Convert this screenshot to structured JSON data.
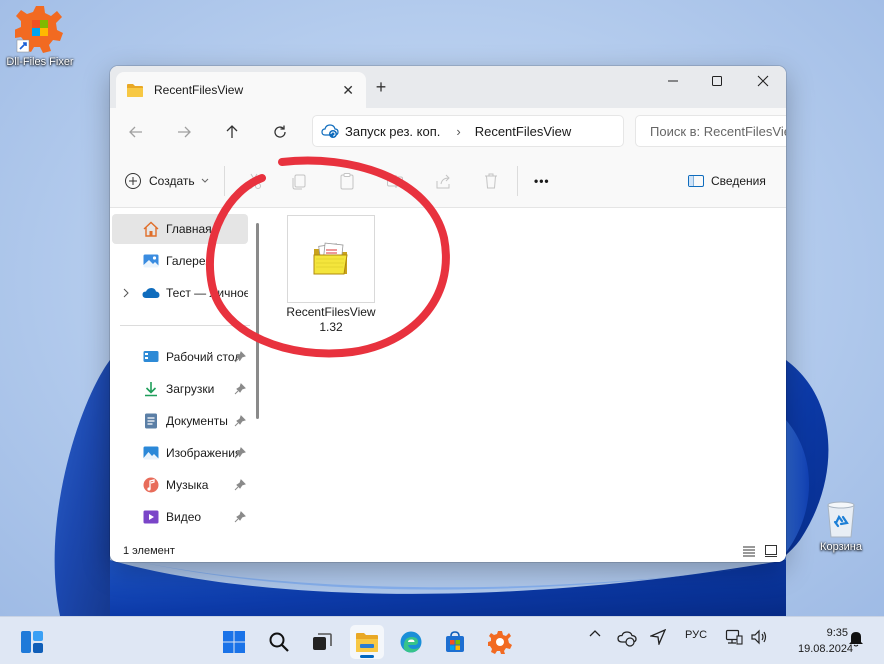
{
  "desktop": {
    "dll_icon_label": "Dll-Files Fixer",
    "recycle_bin_label": "Корзина"
  },
  "window": {
    "tab_title": "RecentFilesView",
    "new_tab": "+",
    "close_tab": "✕"
  },
  "address": {
    "segment1": "Запуск рез. коп.",
    "separator": "›",
    "segment2": "RecentFilesView",
    "search_placeholder": "Поиск в: RecentFilesView"
  },
  "commands": {
    "create_label": "Создать",
    "more_label": "•••",
    "details_label": "Сведения"
  },
  "sidebar": {
    "items": [
      {
        "label": "Главная",
        "icon": "home-icon"
      },
      {
        "label": "Галерея",
        "icon": "gallery-icon"
      },
      {
        "label": "Тест — Личное",
        "icon": "onedrive-icon"
      },
      {
        "label": "Рабочий стол",
        "icon": "desktop-icon"
      },
      {
        "label": "Загрузки",
        "icon": "downloads-icon"
      },
      {
        "label": "Документы",
        "icon": "documents-icon"
      },
      {
        "label": "Изображения",
        "icon": "pictures-icon"
      },
      {
        "label": "Музыка",
        "icon": "music-icon"
      },
      {
        "label": "Видео",
        "icon": "videos-icon"
      }
    ]
  },
  "content": {
    "file_line1": "RecentFilesView",
    "file_line2": "1.32"
  },
  "status": {
    "count": "1 элемент"
  },
  "taskbar": {
    "lang": "РУС",
    "time": "9:35",
    "date": "19.08.2024"
  },
  "colors": {
    "accent": "#0067c0",
    "annotation": "#e8323e",
    "folder": "#f7c844"
  }
}
